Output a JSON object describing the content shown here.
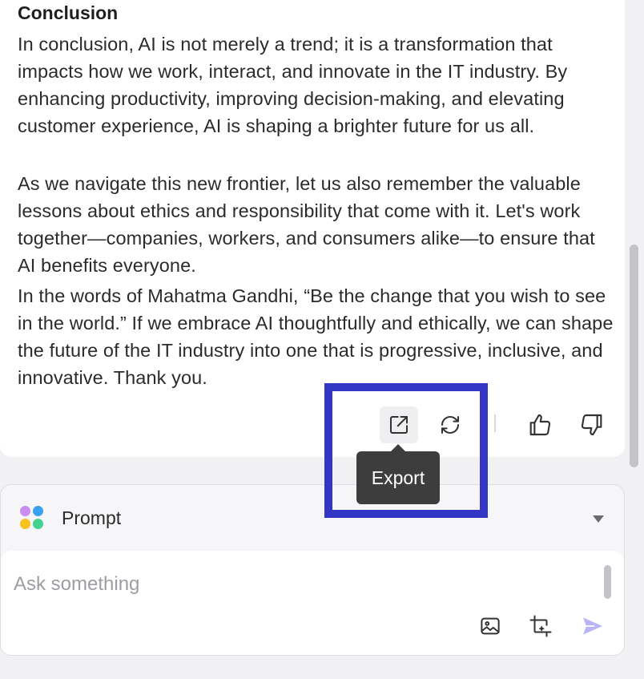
{
  "answer": {
    "heading": "Conclusion",
    "paragraphs": [
      "In conclusion, AI is not merely a trend; it is a transformation that impacts how we work, interact, and innovate in the IT industry. By enhancing productivity, improving decision-making, and elevating customer experience, AI is shaping a brighter future for us all.",
      "As we navigate this new frontier, let us also remember the valuable lessons about ethics and responsibility that come with it. Let's work together—companies, workers, and consumers alike—to ensure that AI benefits everyone.",
      "In the words of Mahatma Gandhi, “Be the change that you wish to see in the world.” If we embrace AI thoughtfully and ethically, we can shape the future of the IT industry into one that is progressive, inclusive, and innovative. Thank you."
    ]
  },
  "actions": {
    "export_icon": "export-icon",
    "regenerate_icon": "refresh-icon",
    "like_icon": "thumbs-up-icon",
    "dislike_icon": "thumbs-down-icon",
    "tooltip": "Export"
  },
  "prompt": {
    "label": "Prompt",
    "placeholder": "Ask something",
    "value": ""
  },
  "colors": {
    "highlight": "#3336c4",
    "tooltip_bg": "#3d3d3d",
    "send": "#b9b4f3"
  }
}
